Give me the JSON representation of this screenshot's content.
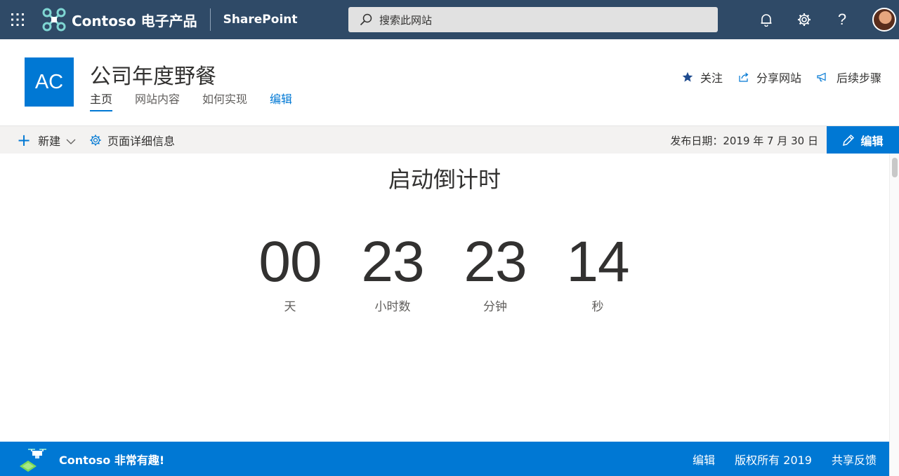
{
  "suite_bar": {
    "brand_name": "Contoso 电子产品",
    "app_name": "SharePoint",
    "search_placeholder": "搜索此网站",
    "background_color": "#2f4a67"
  },
  "site": {
    "logo_text": "AC",
    "title": "公司年度野餐",
    "nav": [
      {
        "label": "主页",
        "active": true
      },
      {
        "label": "网站内容"
      },
      {
        "label": "如何实现"
      },
      {
        "label": "编辑"
      }
    ],
    "actions": {
      "follow": "关注",
      "share": "分享网站",
      "next_steps": "后续步骤"
    }
  },
  "command_bar": {
    "new_label": "新建",
    "page_details_label": "页面详细信息",
    "published": "发布日期：2019 年 7 月 30 日",
    "edit_label": "编辑"
  },
  "countdown": {
    "title": "启动倒计时",
    "units": [
      {
        "value": "00",
        "label": "天"
      },
      {
        "value": "23",
        "label": "小时数"
      },
      {
        "value": "23",
        "label": "分钟"
      },
      {
        "value": "14",
        "label": "秒"
      }
    ]
  },
  "footer": {
    "name": "Contoso 非常有趣!",
    "links": [
      "编辑",
      "版权所有 2019",
      "共享反馈"
    ]
  },
  "colors": {
    "accent": "#0078d4",
    "suite_bar": "#2f4a67",
    "command_bar": "#f3f2f1"
  },
  "icons": [
    "waffle-icon",
    "brand-logo-icon",
    "search-icon",
    "bell-icon",
    "gear-icon",
    "help-icon",
    "star-icon",
    "share-icon",
    "megaphone-icon",
    "plus-icon",
    "chevron-down-icon",
    "gear-outline-icon",
    "pencil-icon",
    "drone-icon"
  ]
}
